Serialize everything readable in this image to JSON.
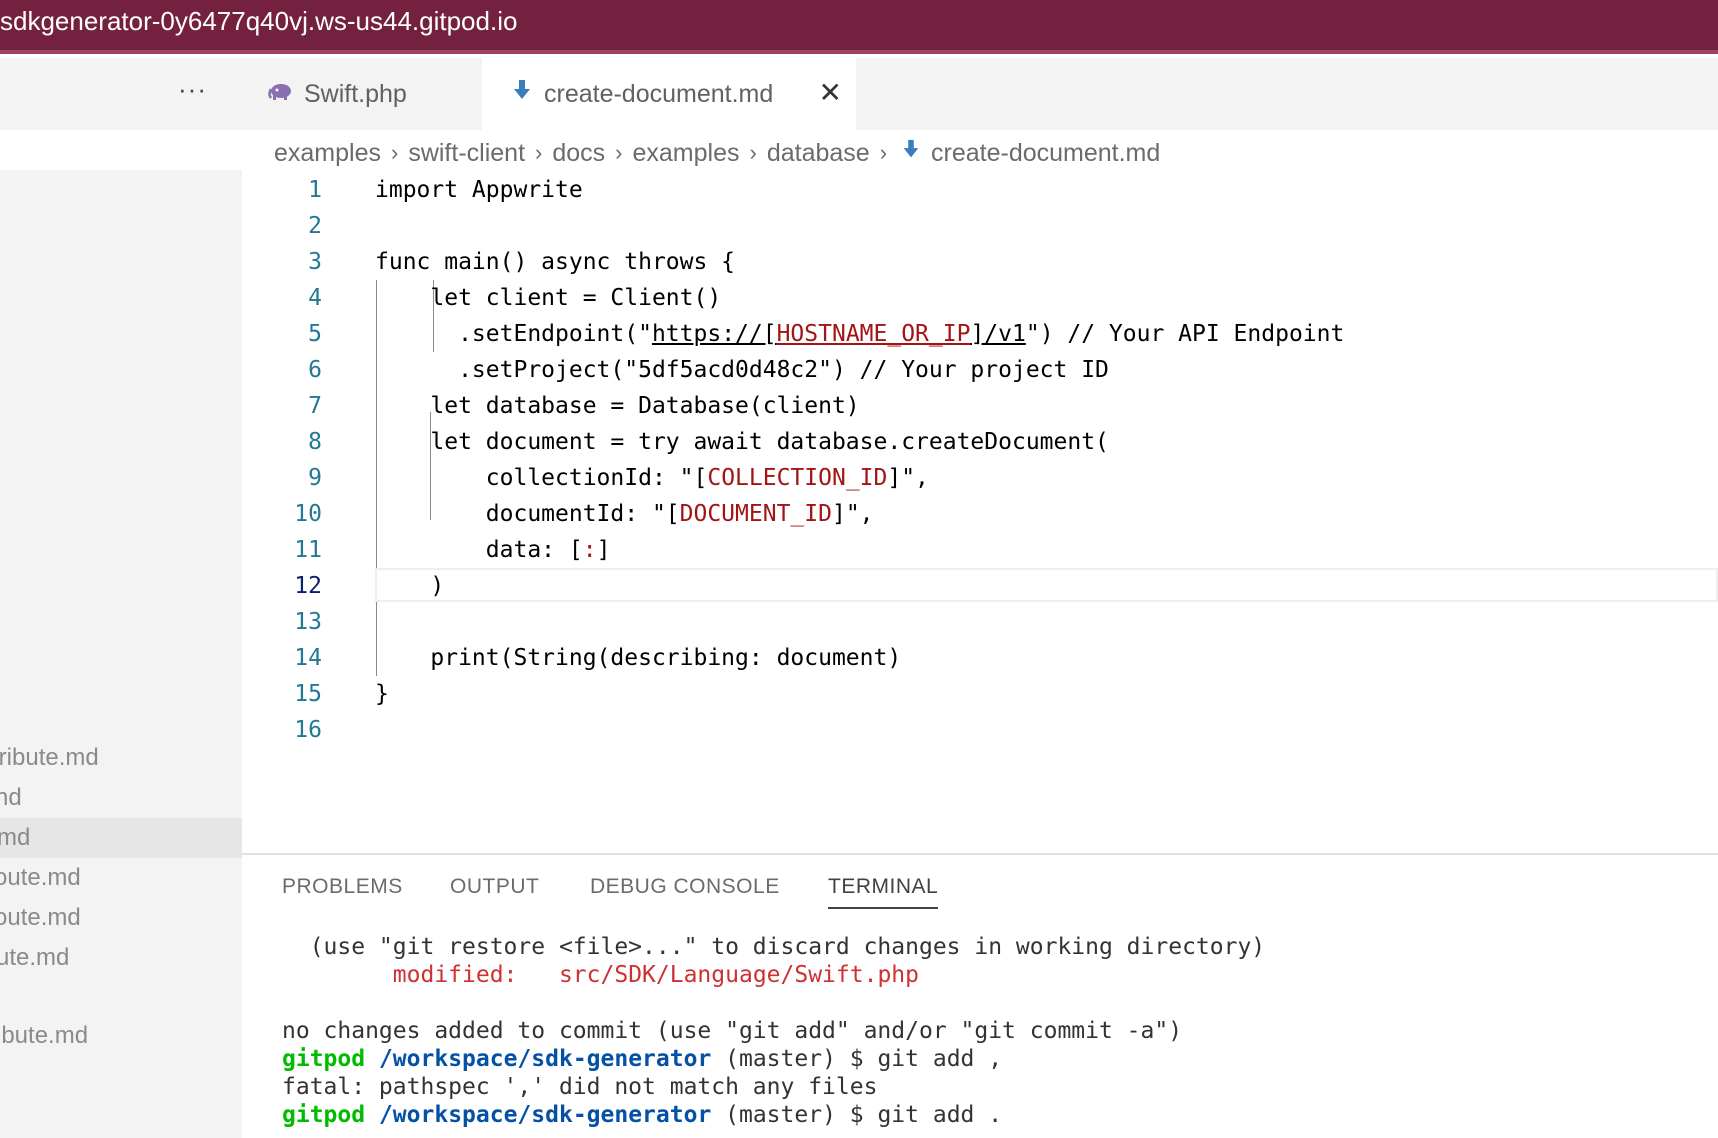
{
  "window": {
    "title": "sdkgenerator-0y6477q40vj.ws-us44.gitpod.io"
  },
  "sidebar": {
    "more_label": "···",
    "files": [
      {
        "label": "tribute.md",
        "highlighted": false
      },
      {
        "label": "nd",
        "highlighted": false
      },
      {
        "label": "md",
        "highlighted": true
      },
      {
        "label": "oute.md",
        "highlighted": false
      },
      {
        "label": "oute.md",
        "highlighted": false
      },
      {
        "label": "ute.md",
        "highlighted": false
      },
      {
        "label": "ibute.md",
        "highlighted": false
      }
    ]
  },
  "tabs": [
    {
      "label": "Swift.php",
      "icon": "php-elephant-icon",
      "active": false
    },
    {
      "label": "create-document.md",
      "icon": "markdown-arrow-icon",
      "active": true,
      "close": "✕"
    }
  ],
  "breadcrumb": [
    "examples",
    "swift-client",
    "docs",
    "examples",
    "database",
    "create-document.md"
  ],
  "editor": {
    "active_line": 12,
    "lines": [
      {
        "num": "1",
        "code": "import Appwrite"
      },
      {
        "num": "2",
        "code": ""
      },
      {
        "num": "3",
        "code": "func main() async throws {"
      },
      {
        "num": "4",
        "code": "    let client = Client()"
      },
      {
        "num": "5",
        "pre": "      .setEndpoint(\"",
        "u1": "https://[",
        "s1": "HOSTNAME_OR_IP",
        "u2": "]/v1",
        "post": "\") // Your API Endpoint"
      },
      {
        "num": "6",
        "code": "      .setProject(\"5df5acd0d48c2\") // Your project ID"
      },
      {
        "num": "7",
        "code": "    let database = Database(client)"
      },
      {
        "num": "8",
        "code": "    let document = try await database.createDocument("
      },
      {
        "num": "9",
        "pre": "        collectionId: \"[",
        "s1": "COLLECTION_ID",
        "post": "]\","
      },
      {
        "num": "10",
        "pre": "        documentId: \"[",
        "s1": "DOCUMENT_ID",
        "post": "]\","
      },
      {
        "num": "11",
        "pre": "        data: [",
        "s1": ":",
        "post": "]"
      },
      {
        "num": "12",
        "code": "    )"
      },
      {
        "num": "13",
        "code": ""
      },
      {
        "num": "14",
        "code": "    print(String(describing: document)"
      },
      {
        "num": "15",
        "code": "}"
      },
      {
        "num": "16",
        "code": ""
      }
    ]
  },
  "panel": {
    "tabs": [
      "PROBLEMS",
      "OUTPUT",
      "DEBUG CONSOLE",
      "TERMINAL"
    ],
    "active_tab": "TERMINAL",
    "terminal": {
      "l1": "  (use \"git restore <file>...\" to discard changes in working directory)",
      "l2_label": "        modified:   ",
      "l2_file": "src/SDK/Language/Swift.php",
      "l3": "no changes added to commit (use \"git add\" and/or \"git commit -a\")",
      "prompt_user": "gitpod",
      "prompt_path": "/workspace/sdk-generator",
      "l4_cmd": " (master) $ git add ,",
      "l5": "fatal: pathspec ',' did not match any files",
      "l6_cmd": " (master) $ git add ."
    }
  },
  "colors": {
    "titlebar": "#74203f",
    "string": "#a31515",
    "line_number": "#237893",
    "term_green": "#00bc00",
    "term_blue": "#0451a5",
    "term_red": "#cd3131"
  }
}
